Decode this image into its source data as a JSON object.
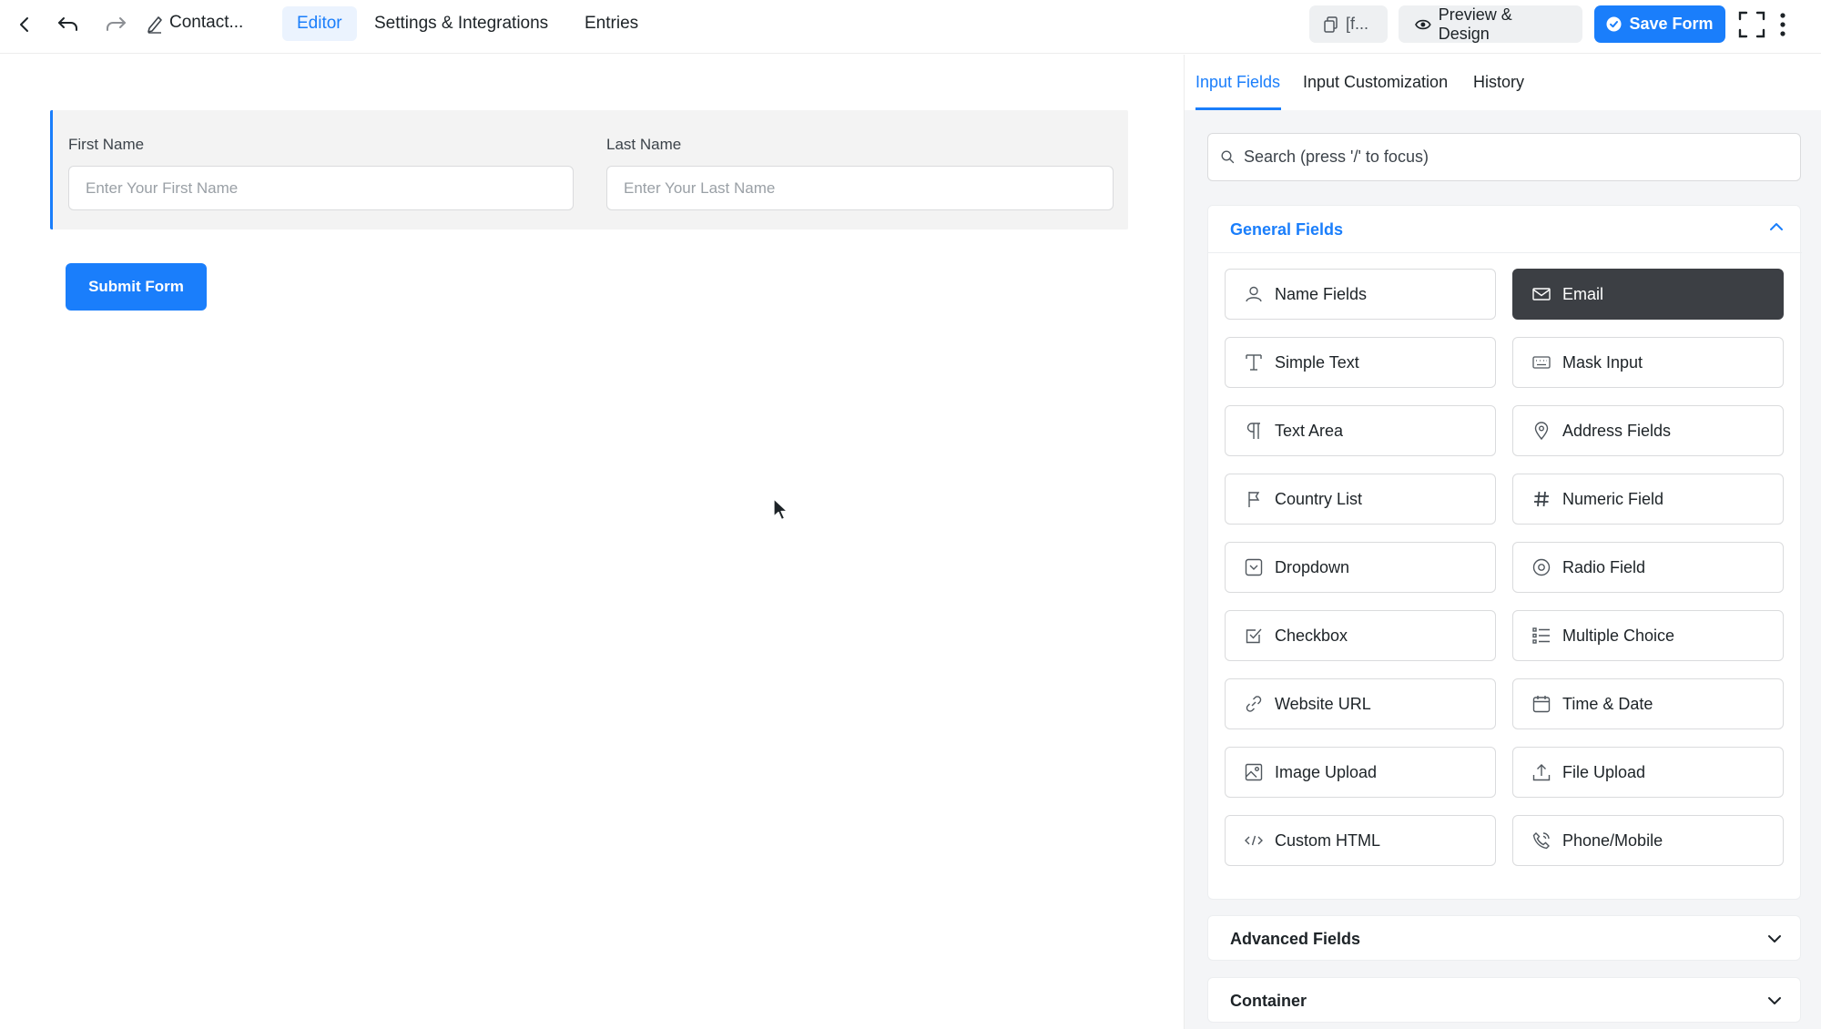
{
  "topbar": {
    "title": "Contact...",
    "tabs": [
      "Editor",
      "Settings & Integrations",
      "Entries"
    ],
    "shortcode_label": "[f...",
    "preview_label": "Preview & Design",
    "save_label": "Save Form"
  },
  "form": {
    "first_name_label": "First Name",
    "first_name_placeholder": "Enter Your First Name",
    "last_name_label": "Last Name",
    "last_name_placeholder": "Enter Your Last Name",
    "submit_label": "Submit Form"
  },
  "panel": {
    "tabs": [
      "Input Fields",
      "Input Customization",
      "History"
    ],
    "search_placeholder": "Search (press '/' to focus)",
    "general_title": "General Fields",
    "fields": [
      {
        "label": "Name Fields",
        "icon": "user-icon"
      },
      {
        "label": "Email",
        "icon": "envelope-icon"
      },
      {
        "label": "Simple Text",
        "icon": "text-cursor-icon"
      },
      {
        "label": "Mask Input",
        "icon": "keyboard-icon"
      },
      {
        "label": "Text Area",
        "icon": "paragraph-icon"
      },
      {
        "label": "Address Fields",
        "icon": "map-pin-icon"
      },
      {
        "label": "Country List",
        "icon": "flag-icon"
      },
      {
        "label": "Numeric Field",
        "icon": "hash-icon"
      },
      {
        "label": "Dropdown",
        "icon": "dropdown-icon"
      },
      {
        "label": "Radio Field",
        "icon": "radio-icon"
      },
      {
        "label": "Checkbox",
        "icon": "checkbox-icon"
      },
      {
        "label": "Multiple Choice",
        "icon": "list-icon"
      },
      {
        "label": "Website URL",
        "icon": "link-icon"
      },
      {
        "label": "Time & Date",
        "icon": "calendar-icon"
      },
      {
        "label": "Image Upload",
        "icon": "image-icon"
      },
      {
        "label": "File Upload",
        "icon": "upload-icon"
      },
      {
        "label": "Custom HTML",
        "icon": "code-icon"
      },
      {
        "label": "Phone/Mobile",
        "icon": "phone-icon"
      }
    ],
    "advanced_title": "Advanced Fields",
    "container_title": "Container"
  },
  "colors": {
    "accent": "#1a7efb",
    "selected_field_bg": "#3c3f44"
  }
}
